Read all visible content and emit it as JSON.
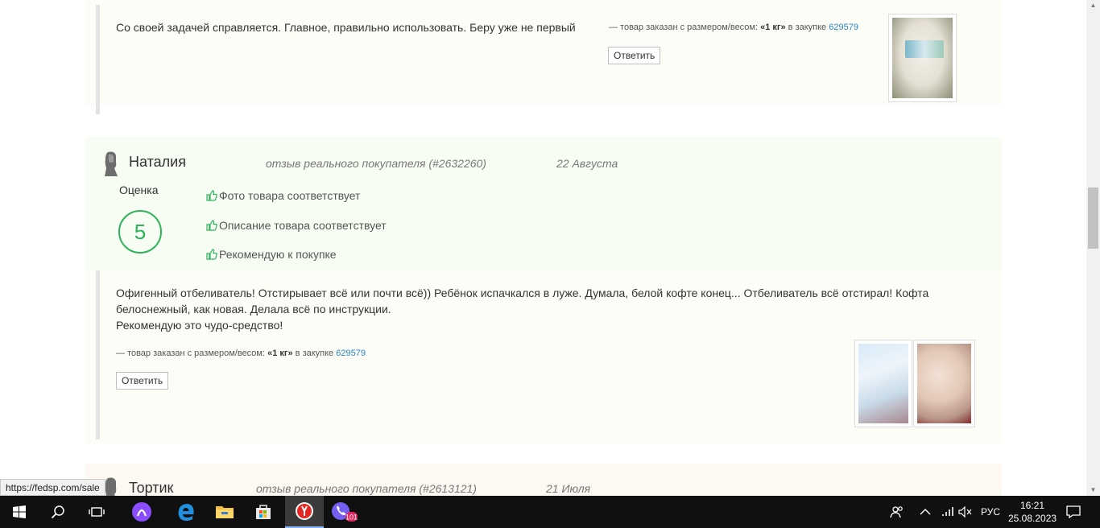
{
  "review1": {
    "text": "Со своей задачей справляется. Главное, правильно использовать. Беру уже не первый",
    "meta_prefix": "—  товар заказан с размером/весом: ",
    "meta_size": "«1 кг»",
    "meta_mid": " в закупке ",
    "meta_link": "629579",
    "reply_label": "Ответить"
  },
  "review2": {
    "author": "Наталия",
    "verified": "отзыв реального покупателя (#2632260)",
    "date": "22 Августа",
    "rating_label": "Оценка",
    "rating": "5",
    "checks": [
      "Фото товара соответствует",
      "Описание товара соответствует",
      "Рекомендую к покупке"
    ],
    "body_line1": "Офигенный отбеливатель! Отстирывает всё или почти всё)) Ребёнок испачкался в луже. Думала, белой кофте конец... Отбеливатель всё отстирал! Кофта белоснежный, как новая. Делала всё по инструкции.",
    "body_line2": "Рекомендую это чудо-средство!",
    "meta_prefix": "—  товар заказан с размером/весом: ",
    "meta_size": "«1 кг»",
    "meta_mid": " в закупке ",
    "meta_link": "629579",
    "reply_label": "Ответить"
  },
  "review3": {
    "author": "Тортик",
    "verified": "отзыв реального покупателя (#2613121)",
    "date": "21 Июля"
  },
  "status_url": "https://fedsp.com/sale",
  "taskbar": {
    "lang": "РУС",
    "time": "16:21",
    "date": "25.08.2023",
    "viber_badge": "101"
  },
  "colors": {
    "accent_green": "#2db35a",
    "link_blue": "#2a85c2"
  }
}
